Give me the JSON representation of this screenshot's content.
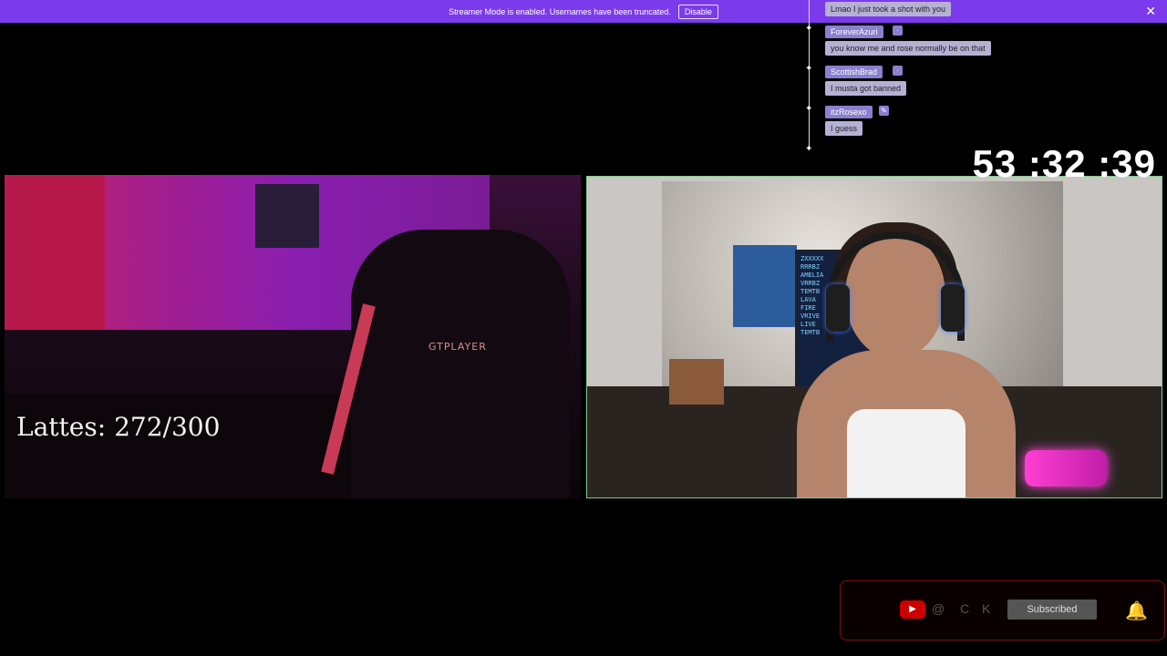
{
  "banner": {
    "message": "Streamer Mode is enabled. Usernames have been truncated.",
    "disable_label": "Disable",
    "close_glyph": "✕"
  },
  "chat": {
    "messages": [
      {
        "username": "",
        "text": "Lmao I just took a shot with you"
      },
      {
        "username": "ForeverAzuri",
        "text": "you know me and rose normally be on that"
      },
      {
        "username": "ScottishBrad",
        "text": "I musta got banned"
      },
      {
        "username": "itzRosexo",
        "text": "I guess"
      }
    ]
  },
  "timer": "53 :32 :39",
  "lattes": "Lattes: 272/300",
  "left_cam": {
    "chair_label": "GTPLAYER"
  },
  "right_cam": {
    "monitor_text": "ZXXXXX\nRRRBZ\nAMELIA\nVRRBZ\nTEMTB\nLAVA\nFIRE\nVRIVE\nLIVE\nTEMTB"
  },
  "subscribe": {
    "label": "Subscribed",
    "icons": [
      "youtube-icon",
      "at-icon",
      "c-icon",
      "k-icon",
      "bell-icon"
    ]
  },
  "colors": {
    "banner": "#7c3aed",
    "chat_name": "#8b7fd0",
    "chat_text_bg": "#b6b0d4",
    "cam_border": "#86c98f",
    "alert_red": "#e20000"
  }
}
